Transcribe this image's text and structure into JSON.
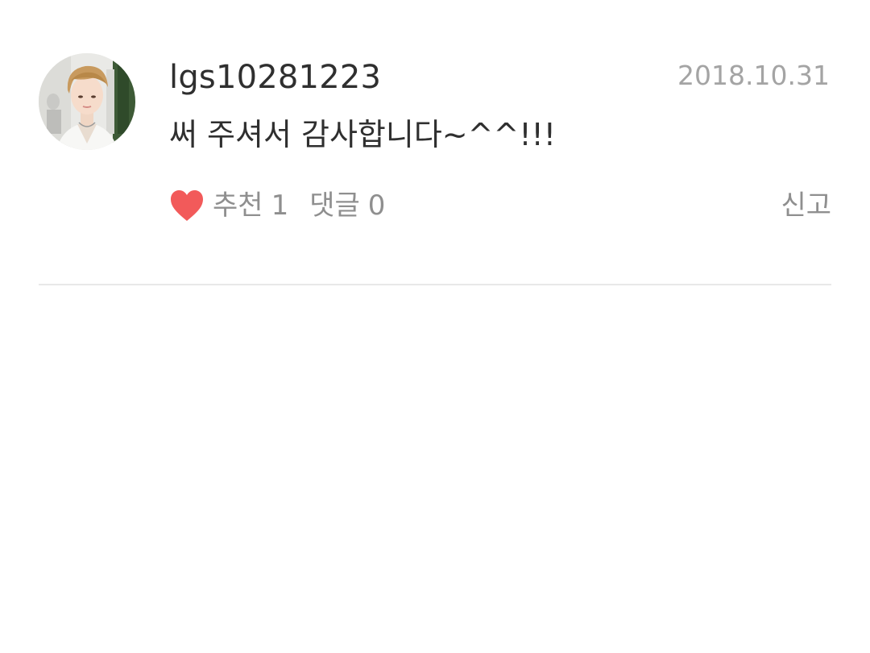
{
  "comment": {
    "username": "lgs10281223",
    "date": "2018.10.31",
    "text": "써 주셔서 감사합니다~^^!!!",
    "avatar_icon": "profile-photo",
    "actions": {
      "like_label": "추천",
      "like_count": "1",
      "reply_label": "댓글",
      "reply_count": "0",
      "report_label": "신고"
    },
    "colors": {
      "heart": "#f25a5a",
      "username": "#2f2f2f",
      "muted": "#8f8f8f",
      "date": "#a4a4a4",
      "divider": "#e8e8e8"
    }
  }
}
